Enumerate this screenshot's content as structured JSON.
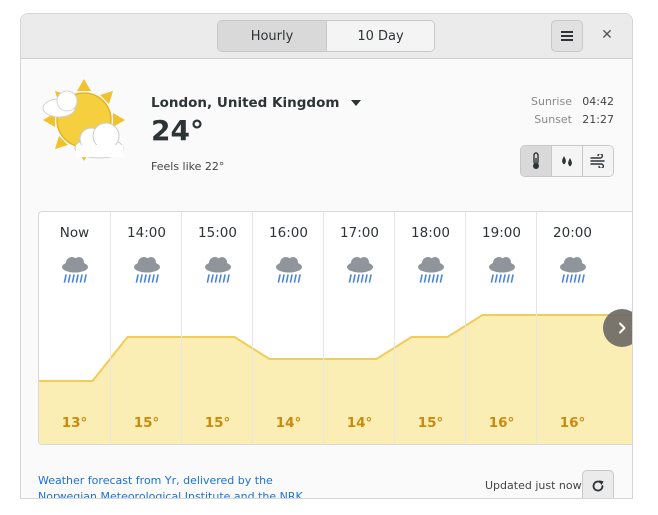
{
  "header": {
    "tabs": [
      {
        "label": "Hourly",
        "active": true
      },
      {
        "label": "10 Day",
        "active": false
      }
    ],
    "menu_icon": "hamburger-icon",
    "close_label": "✕"
  },
  "current": {
    "location": "London, United Kingdom",
    "temperature": "24°",
    "feels_like": "Feels like 22°",
    "condition_icon": "partly-cloudy-icon",
    "sunrise_label": "Sunrise",
    "sunrise_time": "04:42",
    "sunset_label": "Sunset",
    "sunset_time": "21:27"
  },
  "view_modes": [
    {
      "icon": "thermometer-icon",
      "active": true
    },
    {
      "icon": "precipitation-icon",
      "active": false
    },
    {
      "icon": "wind-icon",
      "active": false
    }
  ],
  "hourly": [
    {
      "time": "Now",
      "temp": "13°",
      "value": 13,
      "icon": "rain-icon"
    },
    {
      "time": "14:00",
      "temp": "15°",
      "value": 15,
      "icon": "rain-icon"
    },
    {
      "time": "15:00",
      "temp": "15°",
      "value": 15,
      "icon": "rain-icon"
    },
    {
      "time": "16:00",
      "temp": "14°",
      "value": 14,
      "icon": "rain-icon"
    },
    {
      "time": "17:00",
      "temp": "14°",
      "value": 14,
      "icon": "rain-icon"
    },
    {
      "time": "18:00",
      "temp": "15°",
      "value": 15,
      "icon": "rain-icon"
    },
    {
      "time": "19:00",
      "temp": "16°",
      "value": 16,
      "icon": "rain-icon"
    },
    {
      "time": "20:00",
      "temp": "16°",
      "value": 16,
      "icon": "rain-icon"
    }
  ],
  "footer": {
    "attribution_line1": "Weather forecast from Yr, delivered by the",
    "attribution_line2": "Norwegian Meteorological Institute and the NRK",
    "updated": "Updated just now"
  },
  "colors": {
    "accent_temp": "#c98a10",
    "graph_fill": "#fbeeb4",
    "graph_line": "#f0cd5a",
    "link": "#1c71d8"
  }
}
